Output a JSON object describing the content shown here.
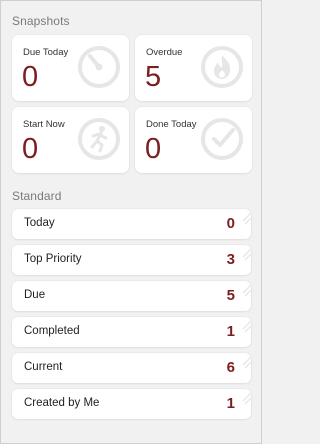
{
  "snapshots": {
    "title": "Snapshots",
    "cards": [
      {
        "label": "Due Today",
        "count": "0",
        "icon": "speedometer-icon"
      },
      {
        "label": "Overdue",
        "count": "5",
        "icon": "fire-icon"
      },
      {
        "label": "Start Now",
        "count": "0",
        "icon": "running-person-icon"
      },
      {
        "label": "Done Today",
        "count": "0",
        "icon": "checkmark-circle-icon"
      }
    ]
  },
  "standard": {
    "title": "Standard",
    "items": [
      {
        "label": "Today",
        "count": "0"
      },
      {
        "label": "Top Priority",
        "count": "3"
      },
      {
        "label": "Due",
        "count": "5"
      },
      {
        "label": "Completed",
        "count": "1"
      },
      {
        "label": "Current",
        "count": "6"
      },
      {
        "label": "Created by Me",
        "count": "1"
      }
    ]
  },
  "colors": {
    "accent": "#7b1f1f",
    "background": "#f1f1f1",
    "card": "#ffffff",
    "icon": "#e6e6e6"
  }
}
